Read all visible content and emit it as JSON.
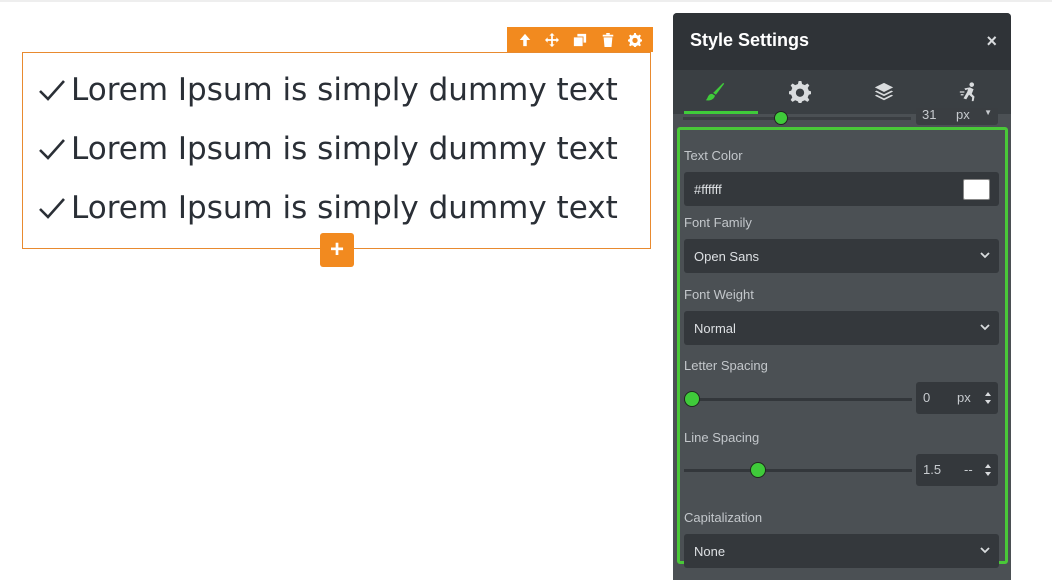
{
  "canvas": {
    "list_items": [
      "Lorem Ipsum is simply dummy text",
      "Lorem Ipsum is simply dummy text",
      "Lorem Ipsum is simply dummy text"
    ],
    "add_label": "+"
  },
  "panel": {
    "title": "Style Settings",
    "close": "×",
    "tabs": [
      "brush-icon",
      "gear-icon",
      "layers-icon",
      "motion-icon"
    ],
    "active_tab": 0,
    "partial_row": {
      "value": "31",
      "unit": "px",
      "fraction": 0.43
    },
    "text_color": {
      "label": "Text Color",
      "value": "#ffffff"
    },
    "font_family": {
      "label": "Font Family",
      "value": "Open Sans"
    },
    "font_weight": {
      "label": "Font Weight",
      "value": "Normal"
    },
    "letter_spacing": {
      "label": "Letter Spacing",
      "value": "0",
      "unit": "px",
      "fraction": 0.0
    },
    "line_spacing": {
      "label": "Line Spacing",
      "value": "1.5",
      "unit": "--",
      "fraction": 0.31
    },
    "capitalization": {
      "label": "Capitalization",
      "value": "None"
    }
  },
  "colors": {
    "accent_orange": "#f28a1f",
    "accent_green": "#3fcb3a",
    "panel_bg": "#4b5054",
    "header_bg": "#2f3337"
  }
}
